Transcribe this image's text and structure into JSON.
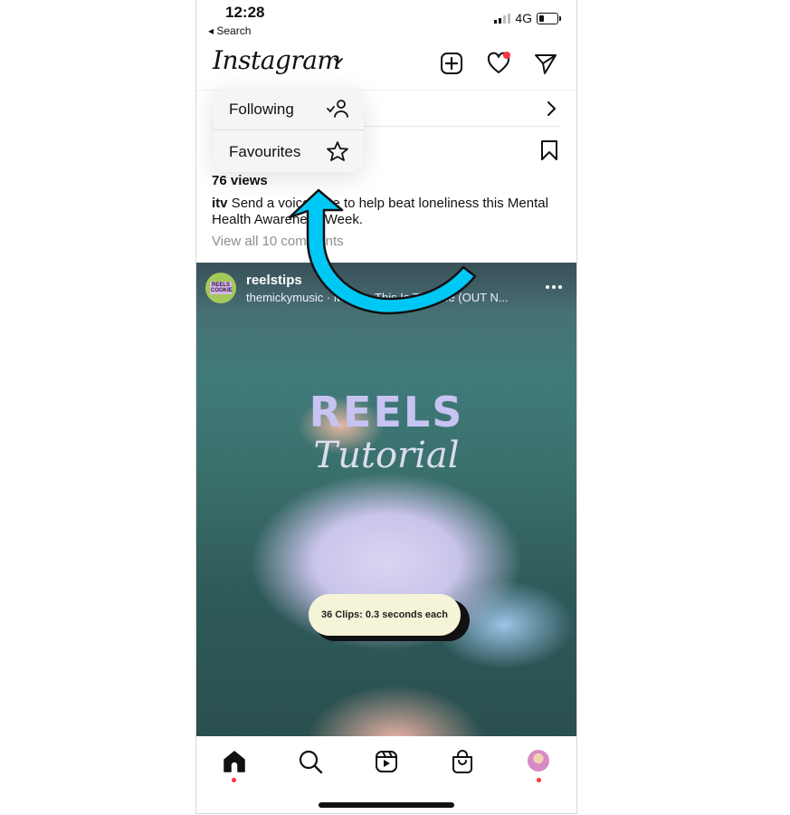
{
  "status_bar": {
    "time": "12:28",
    "back_label": "Search",
    "network": "4G"
  },
  "header": {
    "logo": "Instagram",
    "icons": [
      "chevron-down-icon",
      "create-post-icon",
      "activity-heart-icon",
      "direct-message-icon"
    ],
    "has_activity_notification": true
  },
  "feed_menu": {
    "items": [
      {
        "label": "Following",
        "icon": "following-person-check-icon"
      },
      {
        "label": "Favourites",
        "icon": "star-icon"
      }
    ]
  },
  "post": {
    "views": "76 views",
    "caption_user": "itv",
    "caption_text": " Send a voice note to help beat loneliness this Mental Health Awareness Week.",
    "comments_link": "View all 10 comments"
  },
  "reel": {
    "username": "reelstips",
    "avatar_text": "REELS COOKIE",
    "music": "themickymusic · Music · This Is The Life (OUT N...",
    "overlay_title": "REELS",
    "overlay_subtitle": "Tutorial",
    "pill_text": "36 Clips: 0.3 seconds each",
    "colors": {
      "title": "#c7c3f2",
      "pill_bg": "#f6f4d8"
    }
  },
  "bottom_nav": {
    "items": [
      {
        "name": "home",
        "icon": "home-icon",
        "active": true,
        "dot": true
      },
      {
        "name": "search",
        "icon": "search-icon",
        "active": false,
        "dot": false
      },
      {
        "name": "reels",
        "icon": "reels-icon",
        "active": false,
        "dot": false
      },
      {
        "name": "shop",
        "icon": "shop-bag-icon",
        "active": false,
        "dot": false
      },
      {
        "name": "profile",
        "icon": "profile-avatar",
        "active": false,
        "dot": true
      }
    ]
  },
  "annotation": {
    "type": "curved-arrow",
    "color": "#00c8f5",
    "points_to": "feed_menu"
  }
}
